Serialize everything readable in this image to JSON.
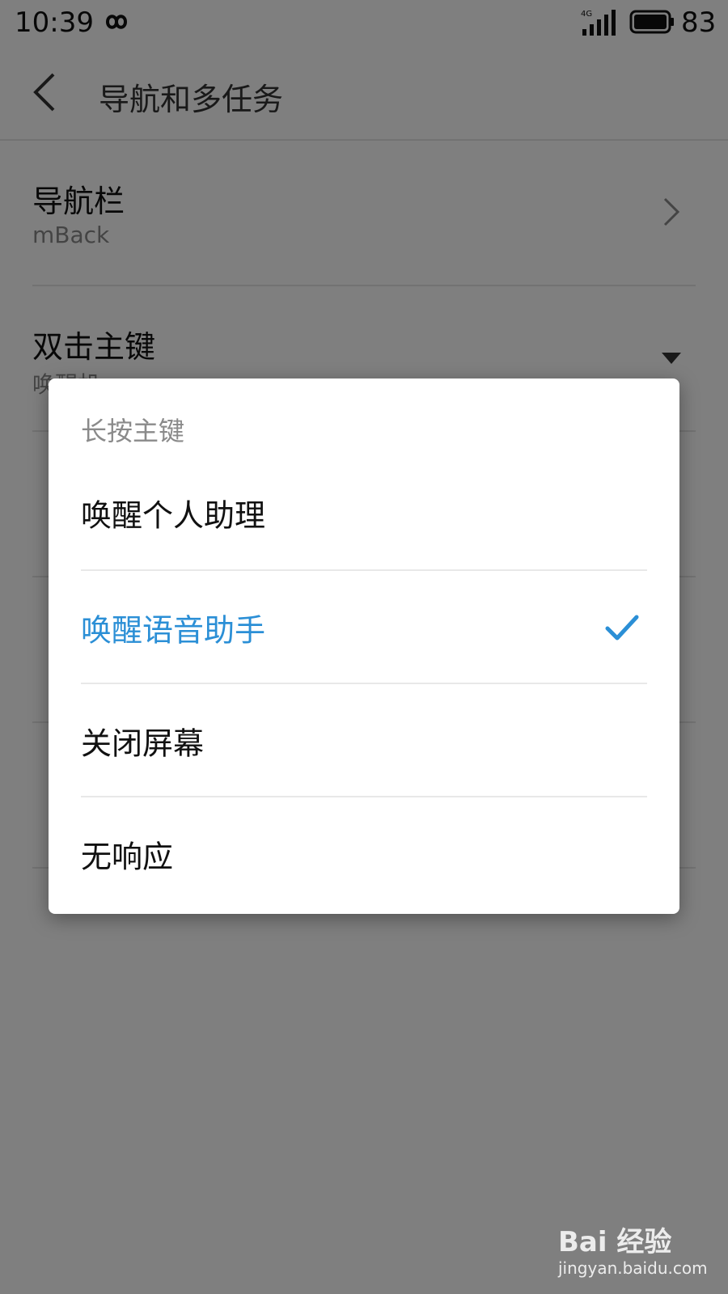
{
  "status_bar": {
    "time": "10:39",
    "network": "4G",
    "battery": "83"
  },
  "header": {
    "title": "导航和多任务"
  },
  "settings": [
    {
      "title": "导航栏",
      "subtitle": "mBack",
      "control": "chevron"
    },
    {
      "title": "双击主键",
      "subtitle": "唤醒机",
      "control": "dropdown"
    }
  ],
  "dialog": {
    "title": "长按主键",
    "options": [
      {
        "label": "唤醒个人助理",
        "selected": false
      },
      {
        "label": "唤醒语音助手",
        "selected": true
      },
      {
        "label": "关闭屏幕",
        "selected": false
      },
      {
        "label": "无响应",
        "selected": false
      }
    ]
  },
  "watermark": {
    "brand": "Bai 经验",
    "url": "jingyan.baidu.com"
  },
  "colors": {
    "accent": "#2b8fd6",
    "scrim": "rgba(0,0,0,0.5)"
  }
}
